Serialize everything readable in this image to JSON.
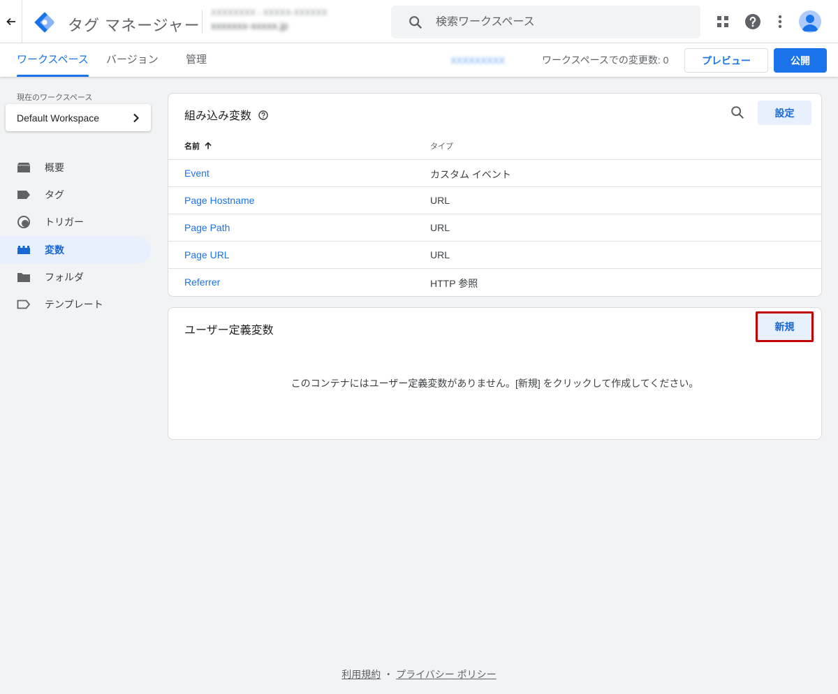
{
  "header": {
    "app_title": "タグ マネージャー",
    "account_line1": "XXXXXXXX - XXXXX-XXXXXX",
    "account_line2": "xxxxxxx-xxxxx.jp",
    "search_placeholder": "検索ワークスペース"
  },
  "subnav": {
    "tabs": [
      "ワークスペース",
      "バージョン",
      "管理"
    ],
    "workspace_id": "XXXXXXXXX",
    "changes_label": "ワークスペースでの変更数: 0",
    "preview_label": "プレビュー",
    "publish_label": "公開"
  },
  "sidebar": {
    "current_workspace_label": "現在のワークスペース",
    "workspace_name": "Default Workspace",
    "items": [
      {
        "label": "概要",
        "icon": "overview-icon"
      },
      {
        "label": "タグ",
        "icon": "tag-icon"
      },
      {
        "label": "トリガー",
        "icon": "trigger-icon"
      },
      {
        "label": "変数",
        "icon": "variables-icon"
      },
      {
        "label": "フォルダ",
        "icon": "folder-icon"
      },
      {
        "label": "テンプレート",
        "icon": "template-icon"
      }
    ],
    "active_index": 3
  },
  "builtin": {
    "title": "組み込み変数",
    "settings_label": "設定",
    "col_name": "名前",
    "col_type": "タイプ",
    "rows": [
      {
        "name": "Event",
        "type": "カスタム イベント"
      },
      {
        "name": "Page Hostname",
        "type": "URL"
      },
      {
        "name": "Page Path",
        "type": "URL"
      },
      {
        "name": "Page URL",
        "type": "URL"
      },
      {
        "name": "Referrer",
        "type": "HTTP 参照"
      }
    ]
  },
  "user_defined": {
    "title": "ユーザー定義変数",
    "new_label": "新規",
    "empty_message": "このコンテナにはユーザー定義変数がありません。[新規] をクリックして作成してください。"
  },
  "footer": {
    "terms": "利用規約",
    "separator": "・",
    "privacy": "プライバシー ポリシー"
  },
  "colors": {
    "accent": "#1a73e8",
    "highlight_border": "#c00000"
  }
}
